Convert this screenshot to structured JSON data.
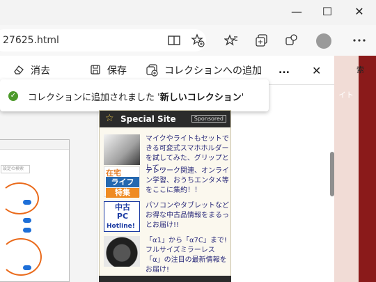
{
  "browser": {
    "url_fragment": "27625.html",
    "window_controls": {
      "minimize": "—",
      "maximize": "☐",
      "close": "✕"
    }
  },
  "collections_bar": {
    "delete_label": "消去",
    "save_label": "保存",
    "add_to_collection_label": "コレクションへの追加",
    "more_label": "...",
    "close_label": "✕"
  },
  "notification": {
    "prefix": "コレクションに追加されました '",
    "collection_name": "新しいコレクション",
    "suffix": "'"
  },
  "ad": {
    "header_title": "Special Site",
    "header_badge": "Sponsored",
    "items": [
      {
        "text": "マイクやライトもセットできる可変式スマホホルダーを試してみた、グリップとして…"
      },
      {
        "text": "テレワーク関連、オンライン学習、おうちエンタメ等をここに集約！！",
        "thumb_lines": [
          "在宅",
          "ライフ",
          "特集"
        ]
      },
      {
        "text": "パソコンやタブレットなどお得な中古品情報をまるっとお届け!!",
        "thumb_lines": [
          "中古",
          "PC",
          "Hotline!"
        ]
      },
      {
        "text": "「α1」から「α7C」まで!フルサイズミラーレス「α」の注目の最新情報をお届け!"
      }
    ]
  },
  "right_side": {
    "snippets": [
      "索",
      "イト"
    ]
  },
  "mini_screenshot": {
    "input_placeholder": "設定の検索"
  },
  "colors": {
    "accent": "#1d6fd8",
    "success": "#4c9a2a",
    "annotation": "#ea6b1c",
    "ad_header": "#2b2b2b"
  }
}
